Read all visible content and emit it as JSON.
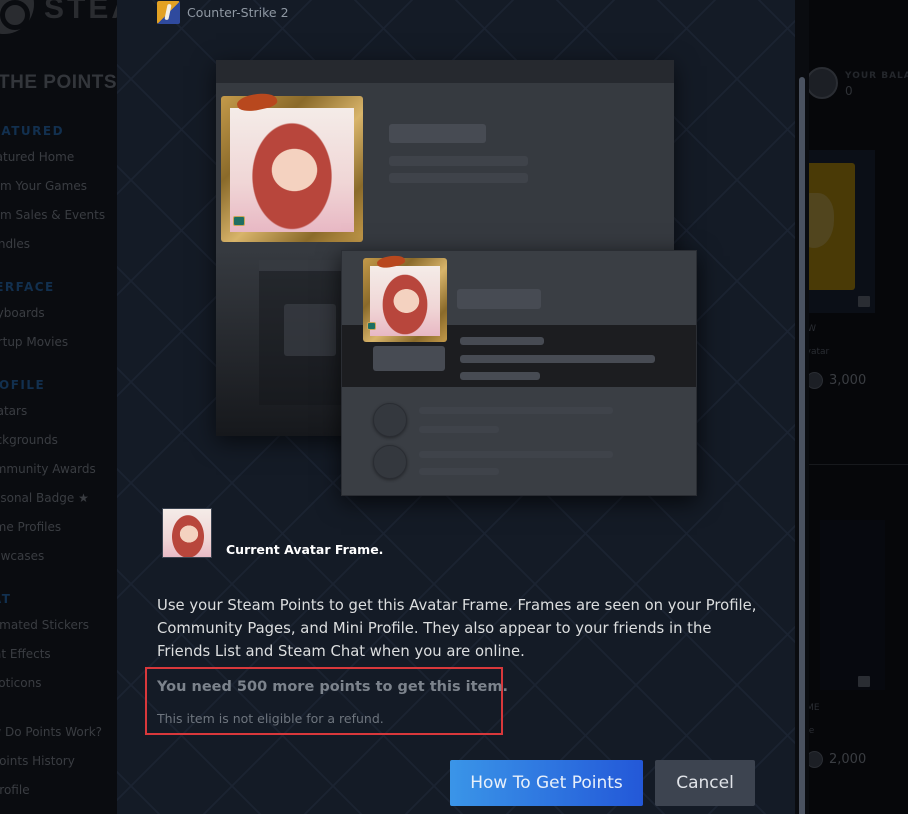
{
  "background": {
    "brand": "STEAM",
    "shop_title": "THE POINTS SHOP",
    "sidebar": {
      "sections": [
        {
          "heading": "FEATURED",
          "items": [
            "Featured Home",
            "From Your Games",
            "From Sales & Events",
            "Bundles"
          ]
        },
        {
          "heading": "INTERFACE",
          "items": [
            "Keyboards",
            "Startup Movies"
          ]
        },
        {
          "heading": "PROFILE",
          "items": [
            "Avatars",
            "Backgrounds",
            "Community Awards",
            "Seasonal Badge ★",
            "Game Profiles",
            "Showcases"
          ]
        },
        {
          "heading": "CHAT",
          "items": [
            "Animated Stickers",
            "Chat Effects",
            "Emoticons"
          ]
        }
      ],
      "footer_links": [
        "How Do Points Work?",
        "My Points History",
        "My Profile"
      ]
    },
    "balance": {
      "label": "YOUR BALANCE",
      "value": "0"
    },
    "cards": [
      {
        "title_fragment": "OW",
        "type_fragment": "Avatar",
        "price": "3,000"
      },
      {
        "title_fragment": "AME",
        "type_fragment": "me",
        "price": "2,000"
      }
    ]
  },
  "modal": {
    "game": {
      "name": "Counter-Strike 2",
      "icon": "cs2-game-icon"
    },
    "current_frame_label": "Current Avatar Frame.",
    "description": "Use your Steam Points to get this Avatar Frame. Frames are seen on your Profile, Community Pages, and Mini Profile. They also appear to your friends in the Friends List and Steam Chat when you are online.",
    "need_points_message": "You need 500 more points to get this item.",
    "refund_notice": "This item is not eligible for a refund.",
    "buttons": {
      "primary": "How To Get Points",
      "cancel": "Cancel"
    },
    "highlight_color": "#d9383b",
    "accent_color": "#2f7de0"
  }
}
